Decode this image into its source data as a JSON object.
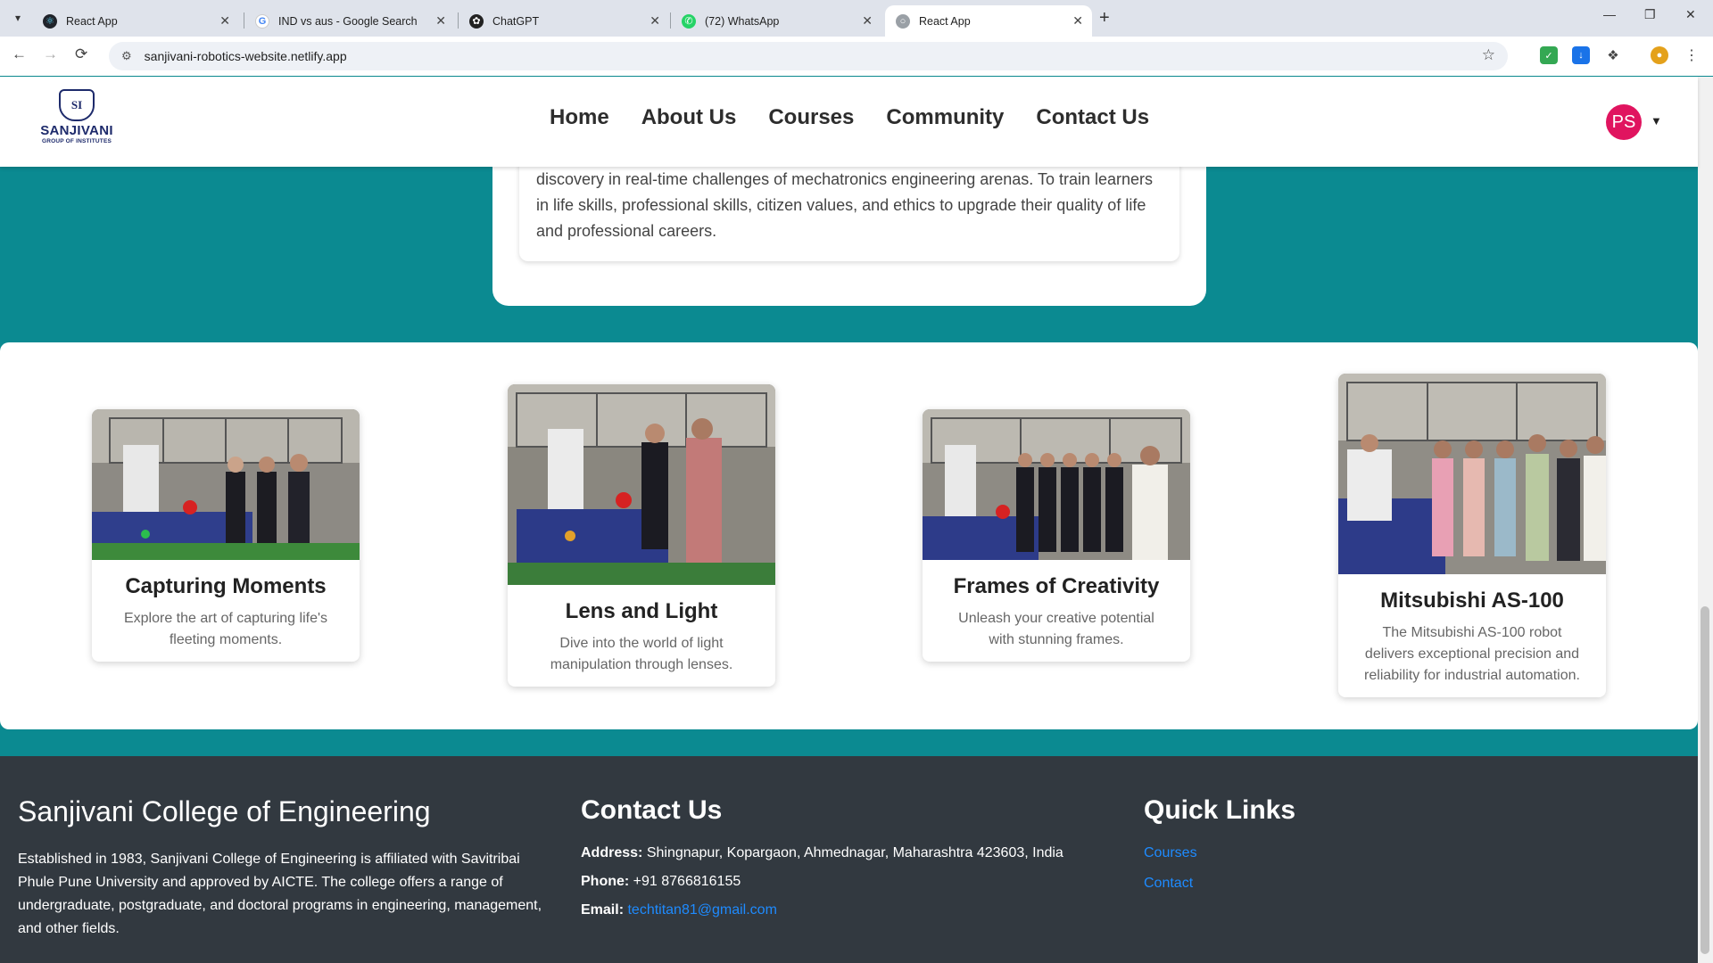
{
  "browser": {
    "tabs": [
      {
        "title": "React App",
        "icon": "react-icon"
      },
      {
        "title": "IND vs aus - Google Search",
        "icon": "google-icon"
      },
      {
        "title": "ChatGPT",
        "icon": "chatgpt-icon"
      },
      {
        "title": "(72) WhatsApp",
        "icon": "whatsapp-icon"
      },
      {
        "title": "React App",
        "icon": "globe-icon"
      }
    ],
    "url": "sanjivani-robotics-website.netlify.app"
  },
  "nav": {
    "logo_name": "SANJIVANI",
    "logo_sub": "GROUP OF INSTITUTES",
    "logo_crest": "SI",
    "links": [
      "Home",
      "About Us",
      "Courses",
      "Community",
      "Contact Us"
    ],
    "avatar_initials": "PS"
  },
  "mission": {
    "text": "discovery in real-time challenges of mechatronics engineering arenas. To train learners in life skills, professional skills, citizen values, and ethics to upgrade their quality of life and professional careers."
  },
  "gallery": [
    {
      "title": "Capturing Moments",
      "desc": "Explore the art of capturing life's fleeting moments."
    },
    {
      "title": "Lens and Light",
      "desc": "Dive into the world of light manipulation through lenses."
    },
    {
      "title": "Frames of Creativity",
      "desc": "Unleash your creative potential with stunning frames."
    },
    {
      "title": "Mitsubishi AS-100",
      "desc": "The Mitsubishi AS-100 robot delivers exceptional precision and reliability for industrial automation."
    }
  ],
  "footer": {
    "college": {
      "title": "Sanjivani College of Engineering",
      "desc": "Established in 1983, Sanjivani College of Engineering is affiliated with Savitribai Phule Pune University and approved by AICTE. The college offers a range of undergraduate, postgraduate, and doctoral programs in engineering, management, and other fields."
    },
    "contact": {
      "title": "Contact Us",
      "address_label": "Address:",
      "address": "Shingnapur, Kopargaon, Ahmednagar, Maharashtra 423603, India",
      "phone_label": "Phone:",
      "phone": "+91 8766816155",
      "email_label": "Email:",
      "email": "techtitan81@gmail.com"
    },
    "quick_links": {
      "title": "Quick Links",
      "items": [
        "Courses",
        "Contact"
      ]
    }
  },
  "colors": {
    "teal_bg": "#0b8a91",
    "footer_bg": "#323940",
    "avatar": "#e0145f",
    "link": "#1e8bff"
  }
}
